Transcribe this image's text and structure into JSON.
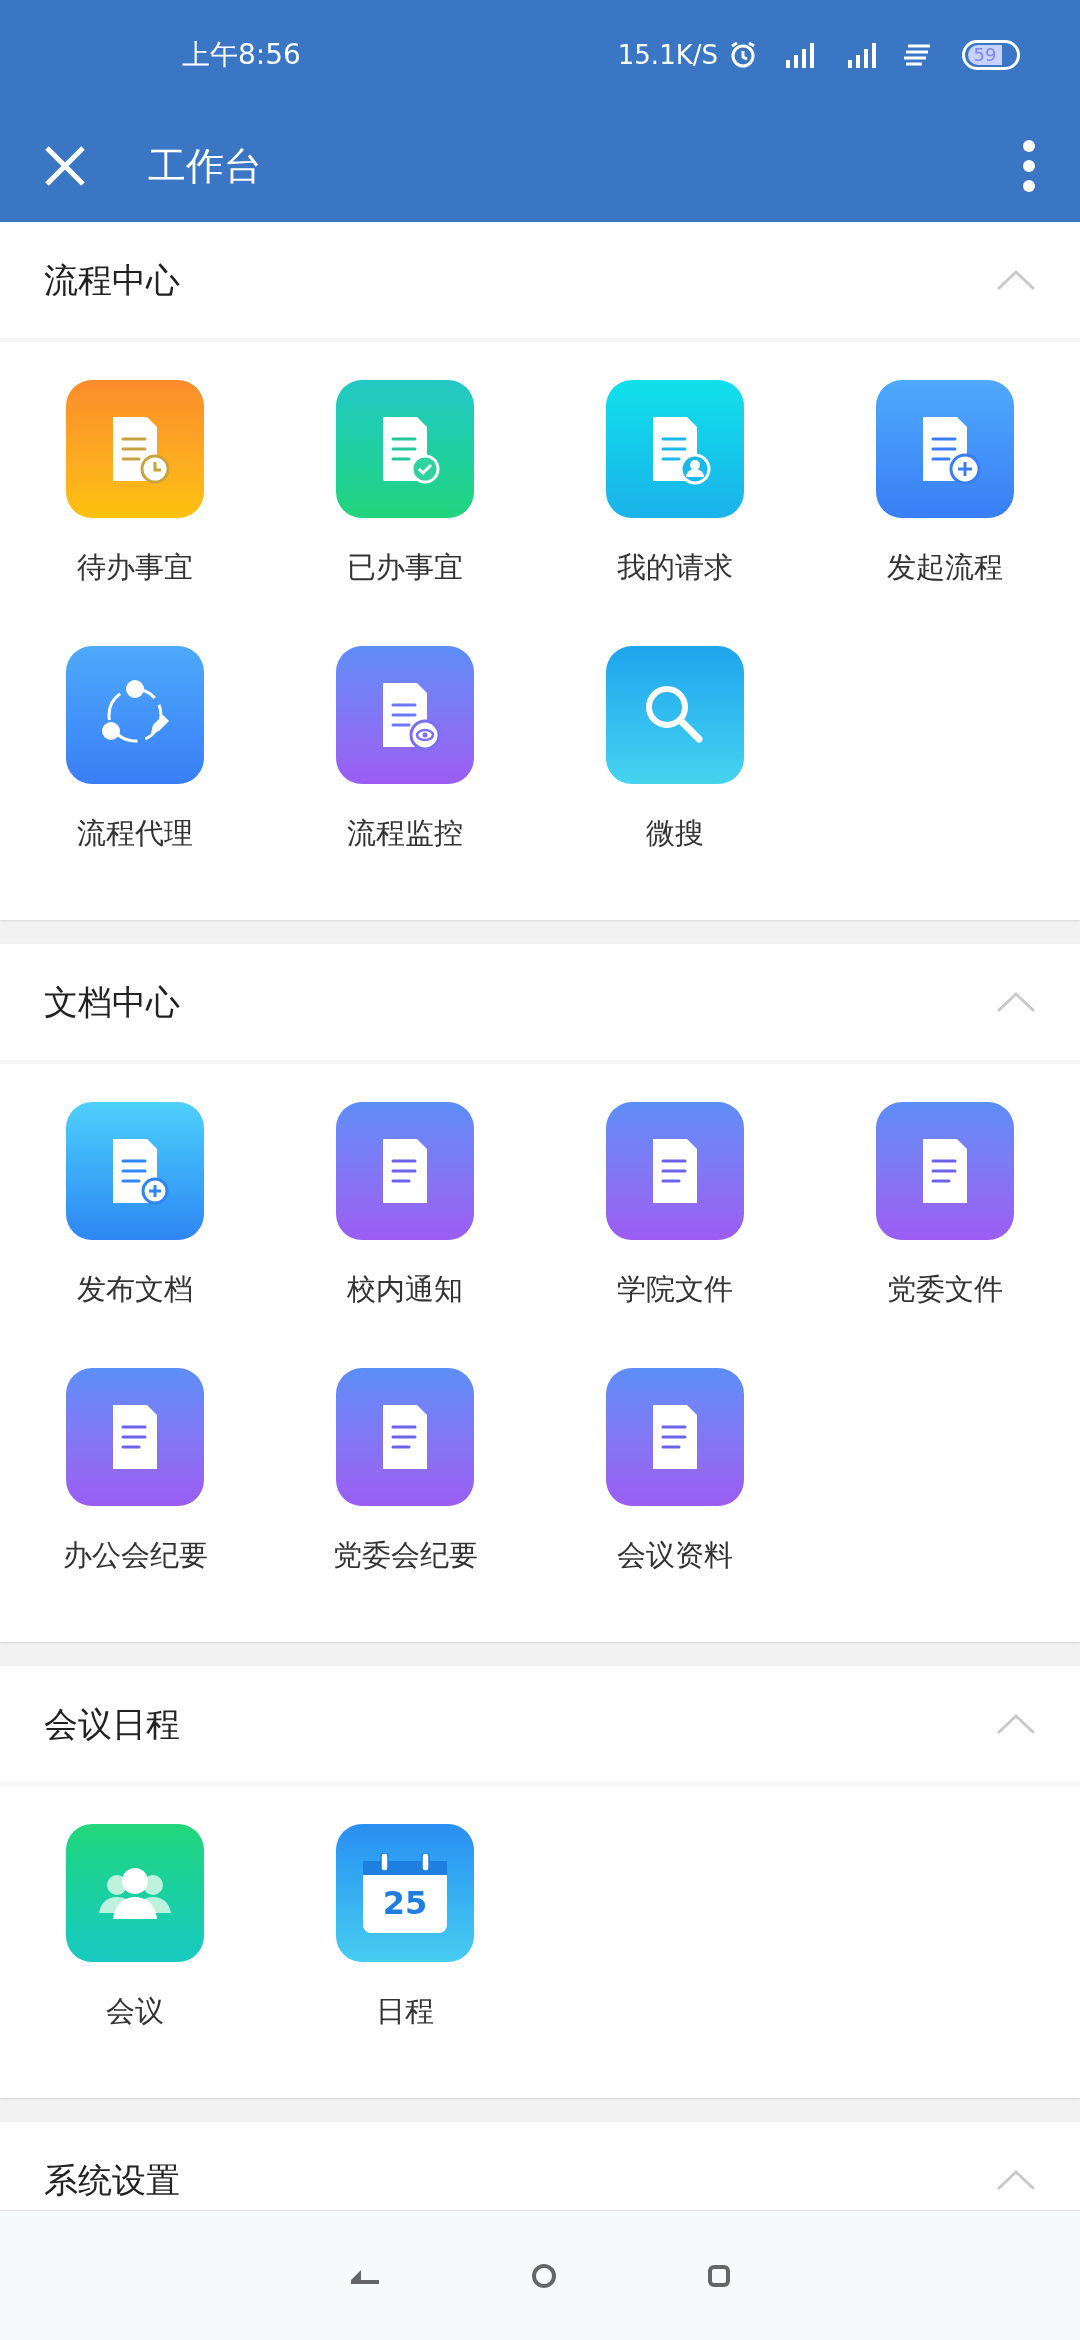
{
  "status_bar": {
    "time": "上午8:56",
    "speed": "15.1K/S",
    "battery": "59"
  },
  "header": {
    "title": "工作台"
  },
  "sections": [
    {
      "title": "流程中心",
      "expanded": true,
      "items": [
        {
          "label": "待办事宜",
          "kind": "pending"
        },
        {
          "label": "已办事宜",
          "kind": "done"
        },
        {
          "label": "我的请求",
          "kind": "request"
        },
        {
          "label": "发起流程",
          "kind": "start"
        },
        {
          "label": "流程代理",
          "kind": "delegate"
        },
        {
          "label": "流程监控",
          "kind": "monitor"
        },
        {
          "label": "微搜",
          "kind": "search"
        }
      ]
    },
    {
      "title": "文档中心",
      "expanded": true,
      "items": [
        {
          "label": "发布文档",
          "kind": "publish"
        },
        {
          "label": "校内通知",
          "kind": "doc"
        },
        {
          "label": "学院文件",
          "kind": "doc"
        },
        {
          "label": "党委文件",
          "kind": "doc"
        },
        {
          "label": "办公会纪要",
          "kind": "doc"
        },
        {
          "label": "党委会纪要",
          "kind": "doc"
        },
        {
          "label": "会议资料",
          "kind": "doc"
        }
      ]
    },
    {
      "title": "会议日程",
      "expanded": true,
      "items": [
        {
          "label": "会议",
          "kind": "meeting"
        },
        {
          "label": "日程",
          "kind": "calendar",
          "day": "25"
        }
      ]
    },
    {
      "title": "系统设置",
      "expanded": true
    }
  ]
}
